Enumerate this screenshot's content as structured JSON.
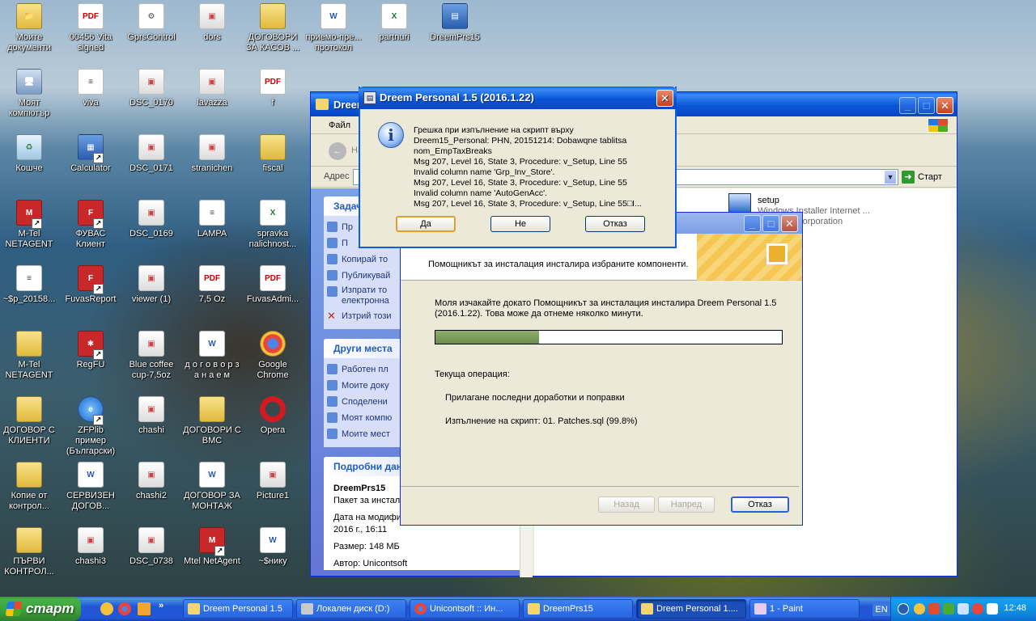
{
  "desktop": {
    "icons": [
      {
        "label": "Моите документи",
        "type": "folder",
        "glyph": "📁"
      },
      {
        "label": "00456 Vita signed",
        "type": "pdf",
        "glyph": "PDF"
      },
      {
        "label": "GprsControl",
        "type": "doc",
        "glyph": "⚙"
      },
      {
        "label": "dors",
        "type": "img",
        "glyph": "▣"
      },
      {
        "label": "ДОГОВОРИ ЗА КАСОВ ...",
        "type": "folder",
        "glyph": ""
      },
      {
        "label": "приемо-пре... протокол",
        "type": "word",
        "glyph": "W"
      },
      {
        "label": "partnuri",
        "type": "excel",
        "glyph": "X"
      },
      {
        "label": "DreemPrs15",
        "type": "app",
        "glyph": "▤"
      },
      {
        "label": "Моят компютър",
        "type": "computer",
        "glyph": "🖥"
      },
      {
        "label": "viva",
        "type": "doc",
        "glyph": "≡"
      },
      {
        "label": "DSC_0170",
        "type": "img",
        "glyph": "▣"
      },
      {
        "label": "lavazza",
        "type": "img",
        "glyph": "▣"
      },
      {
        "label": "f",
        "type": "pdf",
        "glyph": "PDF"
      },
      {
        "label": "Кошче",
        "type": "recycle",
        "glyph": "♻"
      },
      {
        "label": "Calculator",
        "type": "app",
        "glyph": "▦"
      },
      {
        "label": "DSC_0171",
        "type": "img",
        "glyph": "▣"
      },
      {
        "label": "stranichen",
        "type": "img",
        "glyph": "▣"
      },
      {
        "label": "fiscal",
        "type": "folder",
        "glyph": ""
      },
      {
        "label": "M-Tel NETAGENT",
        "type": "red",
        "glyph": "M"
      },
      {
        "label": "ФУВАС Клиент",
        "type": "red",
        "glyph": "F"
      },
      {
        "label": "DSC_0169",
        "type": "img",
        "glyph": "▣"
      },
      {
        "label": "LAMPA",
        "type": "doc",
        "glyph": "≡"
      },
      {
        "label": "spravka nalichnost...",
        "type": "excel",
        "glyph": "X"
      },
      {
        "label": "~$p_20158...",
        "type": "doc",
        "glyph": "≡"
      },
      {
        "label": "FuvasReport",
        "type": "red",
        "glyph": "F"
      },
      {
        "label": "viewer (1)",
        "type": "img",
        "glyph": "▣"
      },
      {
        "label": "7,5 Oz",
        "type": "pdf",
        "glyph": "PDF"
      },
      {
        "label": "FuvasAdmi...",
        "type": "pdf",
        "glyph": "PDF"
      },
      {
        "label": "M-Tel NETAGENT",
        "type": "folder",
        "glyph": ""
      },
      {
        "label": "RegFU",
        "type": "red",
        "glyph": "✱"
      },
      {
        "label": "Blue coffee cup-7,5oz",
        "type": "img",
        "glyph": "▣"
      },
      {
        "label": "д о г о в о р з а н а е м",
        "type": "word",
        "glyph": "W"
      },
      {
        "label": "Google Chrome",
        "type": "chrome",
        "glyph": ""
      },
      {
        "label": "ДОГОВОР С КЛИЕНТИ",
        "type": "folder",
        "glyph": ""
      },
      {
        "label": "ZFPlib пример (Български)",
        "type": "ie",
        "glyph": "e"
      },
      {
        "label": "chashi",
        "type": "img",
        "glyph": "▣"
      },
      {
        "label": "ДОГОВОРИ С ВМС",
        "type": "folder",
        "glyph": ""
      },
      {
        "label": "Opera",
        "type": "opera",
        "glyph": ""
      },
      {
        "label": "Копие от контрол...",
        "type": "folder",
        "glyph": ""
      },
      {
        "label": "СЕРВИЗЕН ДОГОВ...",
        "type": "word",
        "glyph": "W"
      },
      {
        "label": "chashi2",
        "type": "img",
        "glyph": "▣"
      },
      {
        "label": "ДОГОВОР ЗА МОНТАЖ",
        "type": "word",
        "glyph": "W"
      },
      {
        "label": "Picture1",
        "type": "img",
        "glyph": "▣"
      },
      {
        "label": "ПЪРВИ КОНТРОЛ...",
        "type": "folder",
        "glyph": ""
      },
      {
        "label": "chashi3",
        "type": "img",
        "glyph": "▣"
      },
      {
        "label": "DSC_0738",
        "type": "img",
        "glyph": "▣"
      },
      {
        "label": "Mtel NetAgent",
        "type": "red",
        "glyph": "M"
      },
      {
        "label": "~$нику",
        "type": "word",
        "glyph": "W"
      }
    ]
  },
  "explorer": {
    "title": "Dreem",
    "menu_file": "Файл",
    "back_label": "На",
    "address_label": "Адрес",
    "go_label": "Старт",
    "tasks_header": "Задач",
    "tasks": [
      "Пр",
      "П",
      "Копирай то",
      "Публикувай",
      "Изпрати то електронна",
      "Изтрий този"
    ],
    "other_places_header": "Други места",
    "other_places": [
      "Работен пл",
      "Моите доку",
      "Споделени",
      "Моят компю",
      "Моите мест"
    ],
    "details_header": "Подробни дан",
    "details_name": "DreemPrs15",
    "details_type": "Пакет за инстал",
    "details_modified": "Дата на модифициране: 22 Януари 2016 г., 16:11",
    "details_size": "Размер: 148 МБ",
    "details_author": "Автор: Unicontsoft",
    "file_name": "setup",
    "file_desc1": "Windows Installer Internet ...",
    "file_desc2": "Microsoft Corporation",
    "file_partial": "Wi"
  },
  "installer": {
    "subtitle": "Помощникът за инсталация инсталира избраните компоненти.",
    "wait_text": "Моля изчакайте докато Помощникът за инсталация инсталира Dreem Personal 1.5 (2016.1.22). Това може да отнеме няколко минути.",
    "progress_percent": 30,
    "current_op_label": "Текуща операция:",
    "current_op": "Прилагане последни доработки и поправки",
    "script_status": "Изпълнение на скрипт: 01. Patches.sql (99.8%)",
    "back_button": "Назад",
    "next_button": "Напред",
    "cancel_button": "Отказ"
  },
  "dialog": {
    "title": "Dreem Personal 1.5 (2016.1.22)",
    "message": "Грешка при изпълнение на скрипт върху\nDreem15_Personal: PHN, 20151214: Dobawqne tablitsa\nnom_EmpTaxBreaks\nMsg 207, Level 16, State 3, Procedure: v_Setup, Line 55\nInvalid column name 'Grp_Inv_Store'.\nMsg 207, Level 16, State 3, Procedure: v_Setup, Line 55\nInvalid column name 'AutoGenAcc'.\nMsg 207, Level 16, State 3, Procedure: v_Setup, Line 55□I...",
    "yes_button": "Да",
    "no_button": "Не",
    "cancel_button": "Отказ"
  },
  "taskbar": {
    "start_label": "старт",
    "tasks": [
      {
        "label": "Dreem Personal 1.5",
        "kind": "folder",
        "active": false
      },
      {
        "label": "Локален диск (D:)",
        "kind": "disk",
        "active": false
      },
      {
        "label": "Unicontsoft :: Ин...",
        "kind": "chrome",
        "active": false
      },
      {
        "label": "DreemPrs15",
        "kind": "folder",
        "active": false
      },
      {
        "label": "Dreem Personal 1....",
        "kind": "app",
        "active": true
      },
      {
        "label": "1 - Paint",
        "kind": "paint",
        "active": false
      }
    ],
    "language": "EN",
    "clock": "12:48"
  }
}
